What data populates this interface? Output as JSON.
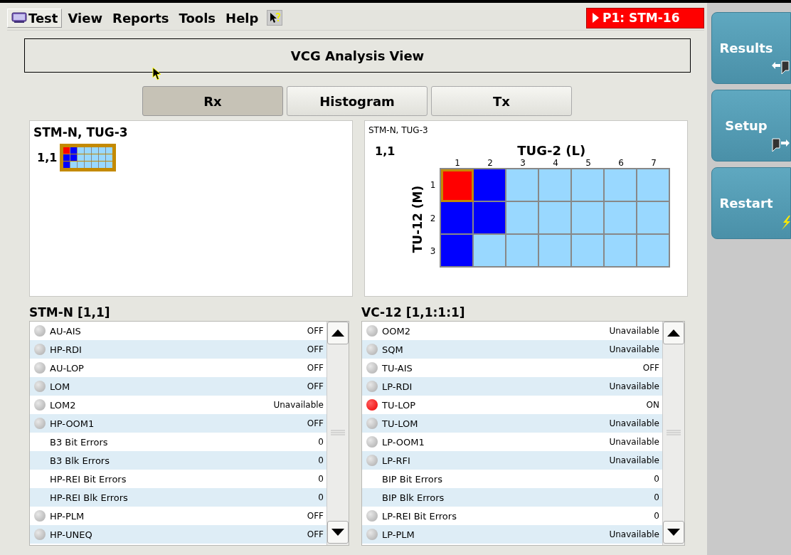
{
  "menu": [
    {
      "label": "Test",
      "selected": true
    },
    {
      "label": "View",
      "selected": false
    },
    {
      "label": "Reports",
      "selected": false
    },
    {
      "label": "Tools",
      "selected": false
    },
    {
      "label": "Help",
      "selected": false
    }
  ],
  "port_badge": "P1: STM-16",
  "view_title": "VCG Analysis View",
  "tabs": [
    {
      "label": "Rx",
      "selected": true
    },
    {
      "label": "Histogram",
      "selected": false
    },
    {
      "label": "Tx",
      "selected": false
    }
  ],
  "overview": {
    "title": "STM-N, TUG-3",
    "block_label": "1,1"
  },
  "detail": {
    "title": "STM-N, TUG-3",
    "block_label": "1,1",
    "x_title": "TUG-2 (L)",
    "y_title": "TU-12 (M)",
    "columns": [
      "1",
      "2",
      "3",
      "4",
      "5",
      "6",
      "7"
    ],
    "rows": [
      {
        "label": "1",
        "cells": [
          {
            "color": "#ff0000",
            "selected": true
          },
          {
            "color": "#0000ff",
            "selected": false
          },
          {
            "color": "#99d8ff",
            "selected": false
          },
          {
            "color": "#99d8ff",
            "selected": false
          },
          {
            "color": "#99d8ff",
            "selected": false
          },
          {
            "color": "#99d8ff",
            "selected": false
          },
          {
            "color": "#99d8ff",
            "selected": false
          }
        ]
      },
      {
        "label": "2",
        "cells": [
          {
            "color": "#0000ff",
            "selected": false
          },
          {
            "color": "#0000ff",
            "selected": false
          },
          {
            "color": "#99d8ff",
            "selected": false
          },
          {
            "color": "#99d8ff",
            "selected": false
          },
          {
            "color": "#99d8ff",
            "selected": false
          },
          {
            "color": "#99d8ff",
            "selected": false
          },
          {
            "color": "#99d8ff",
            "selected": false
          }
        ]
      },
      {
        "label": "3",
        "cells": [
          {
            "color": "#0000ff",
            "selected": false
          },
          {
            "color": "#99d8ff",
            "selected": false
          },
          {
            "color": "#99d8ff",
            "selected": false
          },
          {
            "color": "#99d8ff",
            "selected": false
          },
          {
            "color": "#99d8ff",
            "selected": false
          },
          {
            "color": "#99d8ff",
            "selected": false
          },
          {
            "color": "#99d8ff",
            "selected": false
          }
        ]
      }
    ]
  },
  "lists": [
    {
      "title": "STM-N [1,1]",
      "items": [
        {
          "kind": "alarm",
          "name": "AU-AIS",
          "value": "OFF",
          "on": false
        },
        {
          "kind": "alarm",
          "name": "HP-RDI",
          "value": "OFF",
          "on": false
        },
        {
          "kind": "alarm",
          "name": "AU-LOP",
          "value": "OFF",
          "on": false
        },
        {
          "kind": "alarm",
          "name": "LOM",
          "value": "OFF",
          "on": false
        },
        {
          "kind": "alarm",
          "name": "LOM2",
          "value": "Unavailable",
          "on": false
        },
        {
          "kind": "alarm",
          "name": "HP-OOM1",
          "value": "OFF",
          "on": false
        },
        {
          "kind": "count",
          "name": "B3 Bit Errors",
          "value": "0"
        },
        {
          "kind": "count",
          "name": "B3 Blk Errors",
          "value": "0"
        },
        {
          "kind": "count",
          "name": "HP-REI Bit Errors",
          "value": "0"
        },
        {
          "kind": "count",
          "name": "HP-REI Blk Errors",
          "value": "0"
        },
        {
          "kind": "alarm",
          "name": "HP-PLM",
          "value": "OFF",
          "on": false
        },
        {
          "kind": "alarm",
          "name": "HP-UNEQ",
          "value": "OFF",
          "on": false
        }
      ]
    },
    {
      "title": "VC-12 [1,1:1:1]",
      "items": [
        {
          "kind": "alarm",
          "name": "OOM2",
          "value": "Unavailable",
          "on": false
        },
        {
          "kind": "alarm",
          "name": "SQM",
          "value": "Unavailable",
          "on": false
        },
        {
          "kind": "alarm",
          "name": "TU-AIS",
          "value": "OFF",
          "on": false
        },
        {
          "kind": "alarm",
          "name": "LP-RDI",
          "value": "Unavailable",
          "on": false
        },
        {
          "kind": "alarm",
          "name": "TU-LOP",
          "value": "ON",
          "on": true
        },
        {
          "kind": "alarm",
          "name": "TU-LOM",
          "value": "Unavailable",
          "on": false
        },
        {
          "kind": "alarm",
          "name": "LP-OOM1",
          "value": "Unavailable",
          "on": false
        },
        {
          "kind": "alarm",
          "name": "LP-RFI",
          "value": "Unavailable",
          "on": false
        },
        {
          "kind": "count",
          "name": "BIP Bit Errors",
          "value": "0"
        },
        {
          "kind": "count",
          "name": "BIP Blk Errors",
          "value": "0"
        },
        {
          "kind": "alarm",
          "name": "LP-REI Bit Errors",
          "value": "0",
          "on": false
        },
        {
          "kind": "alarm",
          "name": "LP-PLM",
          "value": "Unavailable",
          "on": false
        }
      ]
    }
  ],
  "side_buttons": [
    {
      "label": "Results"
    },
    {
      "label": "Setup"
    },
    {
      "label": "Restart"
    }
  ]
}
